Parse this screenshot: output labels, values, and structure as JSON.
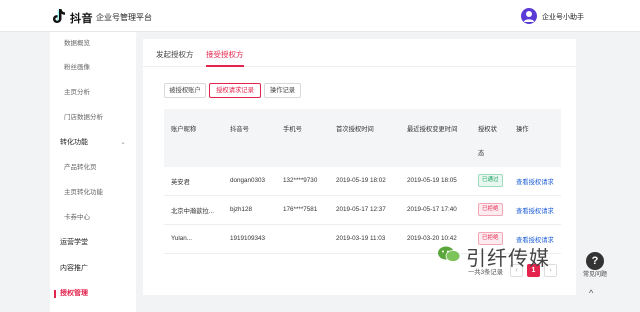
{
  "header": {
    "brand": "抖音",
    "platform": "企业号管理平台",
    "user": "企业号小助手"
  },
  "sidebar": {
    "items": [
      {
        "label": "数据概览"
      },
      {
        "label": "粉丝画像"
      },
      {
        "label": "主页分析"
      },
      {
        "label": "门店数据分析"
      },
      {
        "label": "转化功能"
      },
      {
        "label": "产品转化页"
      },
      {
        "label": "主页转化功能"
      },
      {
        "label": "卡券中心"
      },
      {
        "label": "运营学堂"
      },
      {
        "label": "内容推广"
      },
      {
        "label": "授权管理"
      }
    ]
  },
  "tabs": [
    "发起授权方",
    "接受授权方"
  ],
  "segments": [
    "被授权账户",
    "授权请求记录",
    "操作记录"
  ],
  "table": {
    "headers": [
      "账户昵称",
      "抖音号",
      "手机号",
      "首次授权时间",
      "最近授权变更时间",
      "授权状",
      "操作"
    ],
    "header_wrap": "态",
    "rows": [
      {
        "name": "英安君",
        "douyin": "dongan0303",
        "phone": "132****9730",
        "first": "2019-05-19 18:02",
        "last": "2019-05-19 18:05",
        "status": "已通过",
        "action": "查看授权请求"
      },
      {
        "name": "北京中瀚歆拉...",
        "douyin": "bjzh128",
        "phone": "176****7581",
        "first": "2019-05-17 12:37",
        "last": "2019-05-17 17:40",
        "status": "已拒绝",
        "action": "查看授权请求"
      },
      {
        "name": "Yulan...",
        "douyin": "1919109343",
        "phone": "",
        "first": "2019-03-19 11:03",
        "last": "2019-03-20 10:42",
        "status": "已拒绝",
        "action": "查看授权请求"
      }
    ]
  },
  "pagination": {
    "total": "一共3条记录",
    "prev": "‹",
    "current": "1",
    "next": "›"
  },
  "help": {
    "icon": "?",
    "label": "常见问题",
    "top": "^"
  },
  "watermark": "引纤传媒",
  "colors": {
    "accent": "#e4244c",
    "link": "#1f5fd6",
    "pass": "#19a15f"
  }
}
